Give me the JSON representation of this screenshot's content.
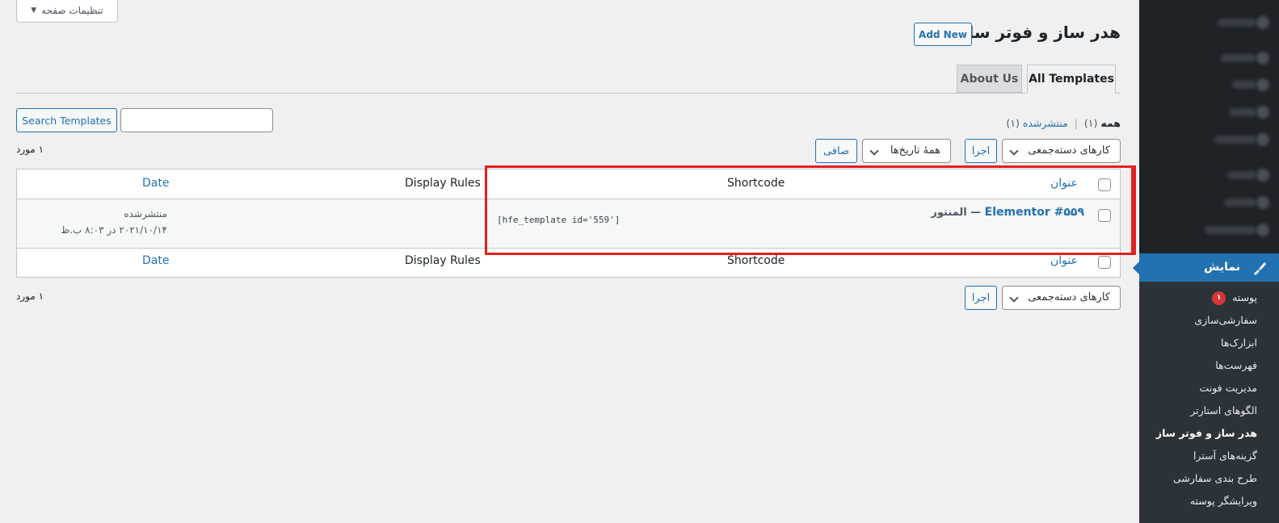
{
  "screen_options": {
    "label": "تنظیمات صفحه"
  },
  "header": {
    "title": "هدر ساز و فوتر ساز",
    "add_new": "Add New"
  },
  "tabs": [
    {
      "label": "All Templates",
      "active": true
    },
    {
      "label": "About Us",
      "active": false
    }
  ],
  "search": {
    "button": "Search Templates",
    "value": ""
  },
  "views": {
    "all_label": "همه",
    "all_count": "(۱)",
    "separator": "|",
    "published_label": "منتشرشده",
    "published_count": "(۱)"
  },
  "tablenav_top": {
    "bulk_actions": "کارهای دسته‌جمعی",
    "apply": "اجرا",
    "dates": "همهٔ تاریخ‌ها",
    "filter": "صافی",
    "count": "۱ مورد"
  },
  "table": {
    "columns": {
      "title": "عنوان",
      "shortcode": "Shortcode",
      "display_rules": "Display Rules",
      "date": "Date"
    },
    "rows": [
      {
        "title": "Elementor #۵۵۹",
        "dash": "—",
        "state": "المنتور",
        "shortcode": "[hfe_template id='559']",
        "status": "منتشرشده",
        "date": "۲۰۲۱/۱۰/۱۴ در ۸:۰۳ ب.ظ"
      }
    ]
  },
  "tablenav_bottom": {
    "bulk_actions": "کارهای دسته‌جمعی",
    "apply": "اجرا",
    "count": "۱ مورد"
  },
  "sidebar": {
    "current": {
      "label": "نمایش",
      "icon": "paintbrush-icon"
    },
    "submenu": [
      {
        "label": "پوسته",
        "badge": "۱"
      },
      {
        "label": "سفارشی‌سازی"
      },
      {
        "label": "ابزارک‌ها"
      },
      {
        "label": "فهرست‌ها"
      },
      {
        "label": "مدیریت فونت"
      },
      {
        "label": "الگوهای استارتر"
      },
      {
        "label": "هدر ساز و فوتر ساز",
        "current": true
      },
      {
        "label": "گزینه‌های آسترا"
      },
      {
        "label": "طرح بندی سفارشی"
      },
      {
        "label": "ویرایشگر پوسته"
      }
    ]
  },
  "colors": {
    "accent": "#2271b1",
    "sidebar_bg": "#1d2327",
    "submenu_bg": "#2c3338",
    "highlight": "#e02020",
    "badge": "#d63638"
  }
}
